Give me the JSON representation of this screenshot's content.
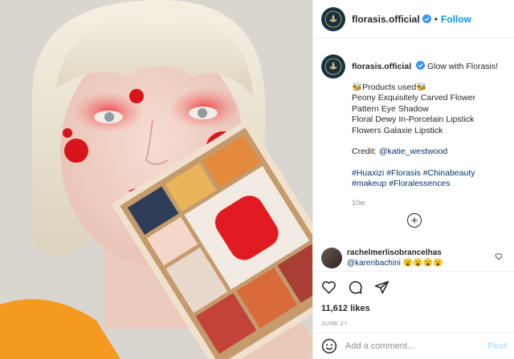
{
  "header": {
    "username": "florasis.official",
    "separator": "•",
    "follow_label": "Follow"
  },
  "caption": {
    "username": "florasis.official",
    "intro": "Glow with Florasis!",
    "products_heading": "🐝Products used🐝",
    "products": [
      "Peony Exquisitely Carved Flower",
      "Pattern Eye Shadow",
      "Floral Dewy In-Porcelain Lipstick",
      "Flowers Galaxie Lipstick"
    ],
    "credit_label": "Credit: ",
    "credit_handle": "@katie_westwood",
    "hashtags_line1": "#Huaxizi #Florasis #Chinabeauty",
    "hashtags_line2": "#makeup #Floralessences",
    "time_ago": "10w"
  },
  "load_more": "+",
  "comment": {
    "username": "rachelmerlisobrancelhas",
    "mention": "@karenbachini",
    "emojis": "😮😮😮😮"
  },
  "actions": {
    "likes": "11,612 likes",
    "date": "JUNE 27"
  },
  "add_comment": {
    "placeholder": "Add a comment...",
    "post_label": "Post"
  },
  "colors": {
    "accent": "#0095f6",
    "post_disabled": "#b2dffc",
    "brand_avatar": "#173340"
  }
}
